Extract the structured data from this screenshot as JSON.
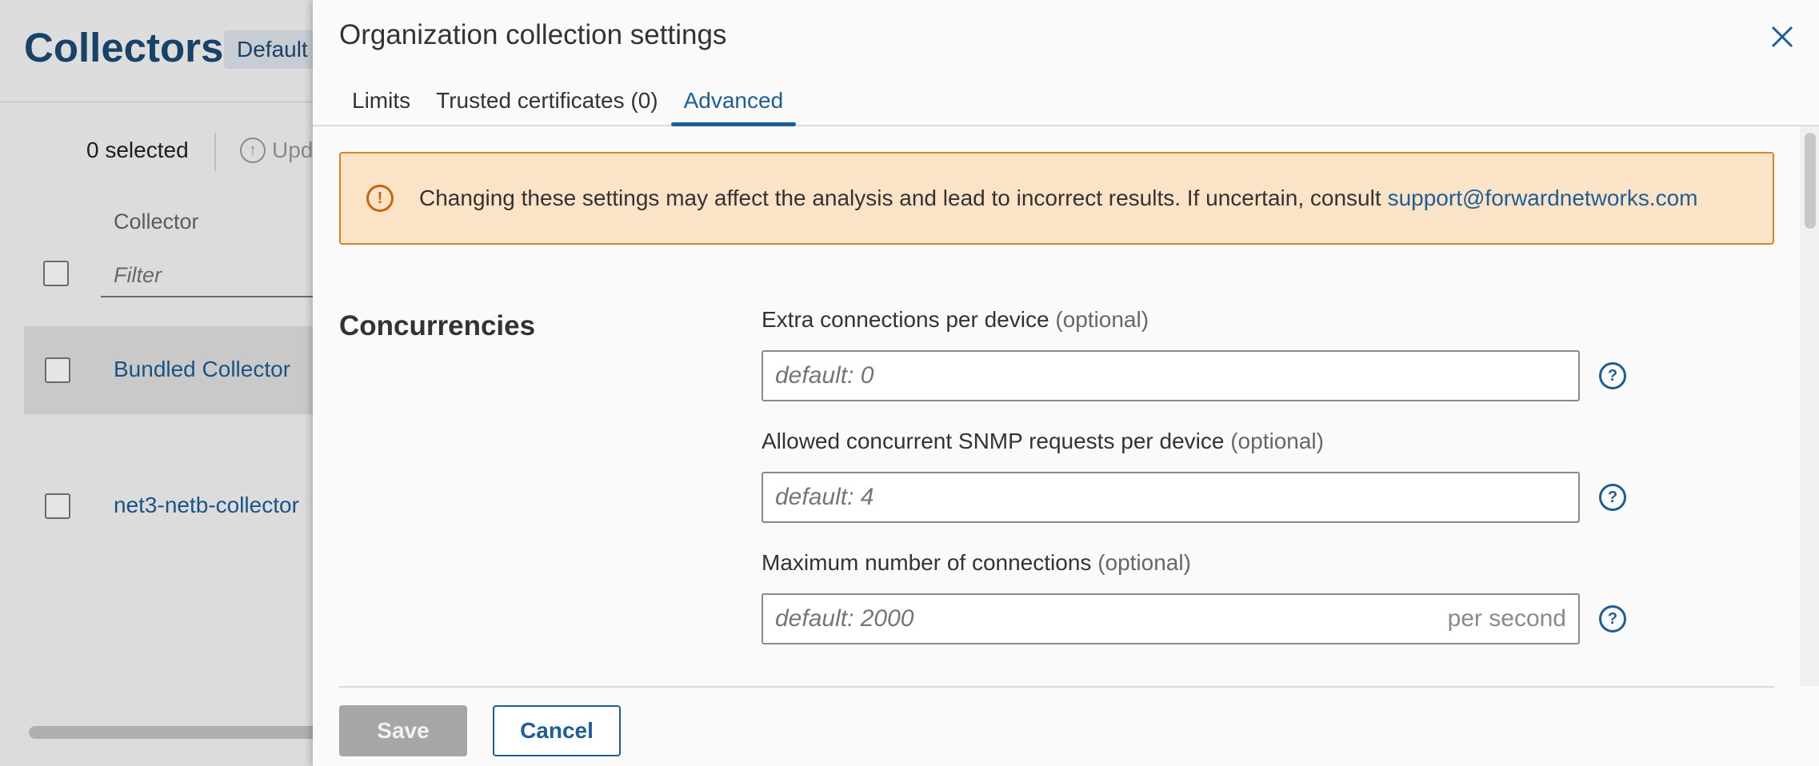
{
  "background_page": {
    "title": "Collectors",
    "org_badge": "Default",
    "selected_count": "0 selected",
    "update_label": "Upd",
    "column_header": "Collector",
    "filter_placeholder": "Filter",
    "rows": [
      {
        "name": "Bundled Collector"
      },
      {
        "name": "net3-netb-collector"
      }
    ]
  },
  "drawer": {
    "title": "Organization collection settings",
    "tabs": [
      {
        "label": "Limits"
      },
      {
        "label": "Trusted certificates (0)"
      },
      {
        "label": "Advanced",
        "active": true
      }
    ],
    "warning": {
      "text": "Changing these settings may affect the analysis and lead to incorrect results. If uncertain, consult",
      "link": "support@forwardnetworks.com"
    },
    "section_title": "Concurrencies",
    "fields": [
      {
        "label": "Extra connections per device",
        "optional": "(optional)",
        "placeholder": "default: 0",
        "value": "",
        "suffix": ""
      },
      {
        "label": "Allowed concurrent SNMP requests per device",
        "optional": "(optional)",
        "placeholder": "default: 4",
        "value": "",
        "suffix": ""
      },
      {
        "label": "Maximum number of connections",
        "optional": "(optional)",
        "placeholder": "default: 2000",
        "value": "",
        "suffix": "per second"
      }
    ],
    "save_label": "Save",
    "cancel_label": "Cancel"
  },
  "colors": {
    "accent": "#1d5e96",
    "warning_bg": "#fbe3c7",
    "warning_border": "#d9822b",
    "save_disabled": "#a6a6a6"
  }
}
